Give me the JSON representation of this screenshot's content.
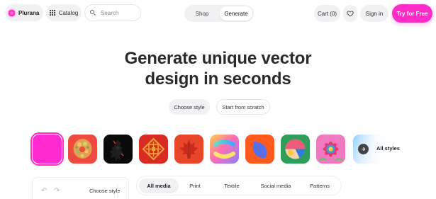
{
  "nav": {
    "brand": "Plurana",
    "catalog": "Catalog",
    "search_placeholder": "Search",
    "tabs": [
      {
        "label": "Shop",
        "active": false
      },
      {
        "label": "Generate",
        "active": true
      }
    ],
    "cart": "Cart (0)",
    "sign_in": "Sign in",
    "cta": "Try for Free",
    "accent_color": "#ff2bc8"
  },
  "hero": {
    "title_line1": "Generate unique vector",
    "title_line2": "design in seconds",
    "choose_style": "Choose style",
    "start_from_scratch": "Start from scratch"
  },
  "style_tiles": [
    {
      "name": "solid-magenta",
      "selected": true
    },
    {
      "name": "floral-ornament",
      "selected": false
    },
    {
      "name": "dark-silhouette",
      "selected": false
    },
    {
      "name": "geometric-tribal",
      "selected": false
    },
    {
      "name": "maple-leaf",
      "selected": false
    },
    {
      "name": "gradient-wave",
      "selected": false
    },
    {
      "name": "blue-leaf-on-orange",
      "selected": false
    },
    {
      "name": "abstract-circle",
      "selected": false
    },
    {
      "name": "flower-mandala",
      "selected": false
    }
  ],
  "all_styles": "All styles",
  "panel": {
    "choose_style": "Choose style"
  },
  "media_tabs": [
    {
      "label": "All media",
      "active": true
    },
    {
      "label": "Print",
      "active": false
    },
    {
      "label": "Textile",
      "active": false
    },
    {
      "label": "Social media",
      "active": false
    },
    {
      "label": "Patterns",
      "active": false
    }
  ]
}
